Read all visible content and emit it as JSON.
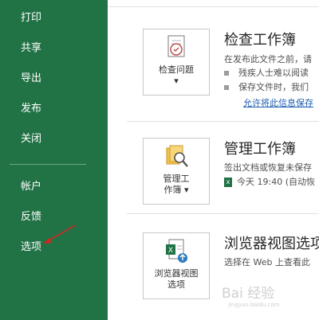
{
  "sidebar": {
    "items": [
      {
        "label": "打印"
      },
      {
        "label": "共享"
      },
      {
        "label": "导出"
      },
      {
        "label": "发布"
      },
      {
        "label": "关闭"
      },
      {
        "label": "帐户"
      },
      {
        "label": "反馈"
      },
      {
        "label": "选项"
      }
    ],
    "bg_color": "#217346"
  },
  "sections": [
    {
      "button_label_line1": "检查问题",
      "button_label_line2": "",
      "title": "检查工作簿",
      "description": "在发布此文件之前，请",
      "bullets": [
        "残疾人士难以阅读",
        "保存文件时，我们"
      ],
      "link": "允许将此信息保存",
      "icon": "inspect-document-icon"
    },
    {
      "button_label_line1": "管理工",
      "button_label_line2": "作簿",
      "title": "管理工作簿",
      "description": "签出文档或恢复未保存",
      "version_text": "今天 19:40 (自动恢",
      "icon": "manage-workbook-icon"
    },
    {
      "button_label_line1": "浏览器视图",
      "button_label_line2": "选项",
      "title": "浏览器视图选项",
      "description": "选择在 Web 上查看此",
      "icon": "browser-view-icon"
    }
  ],
  "watermark": {
    "text": "Bai 经验",
    "sub": "jingyan.baidu.com"
  },
  "accent_color": "#217346",
  "link_color": "#1e5fb4",
  "arrow_color": "#e02020"
}
